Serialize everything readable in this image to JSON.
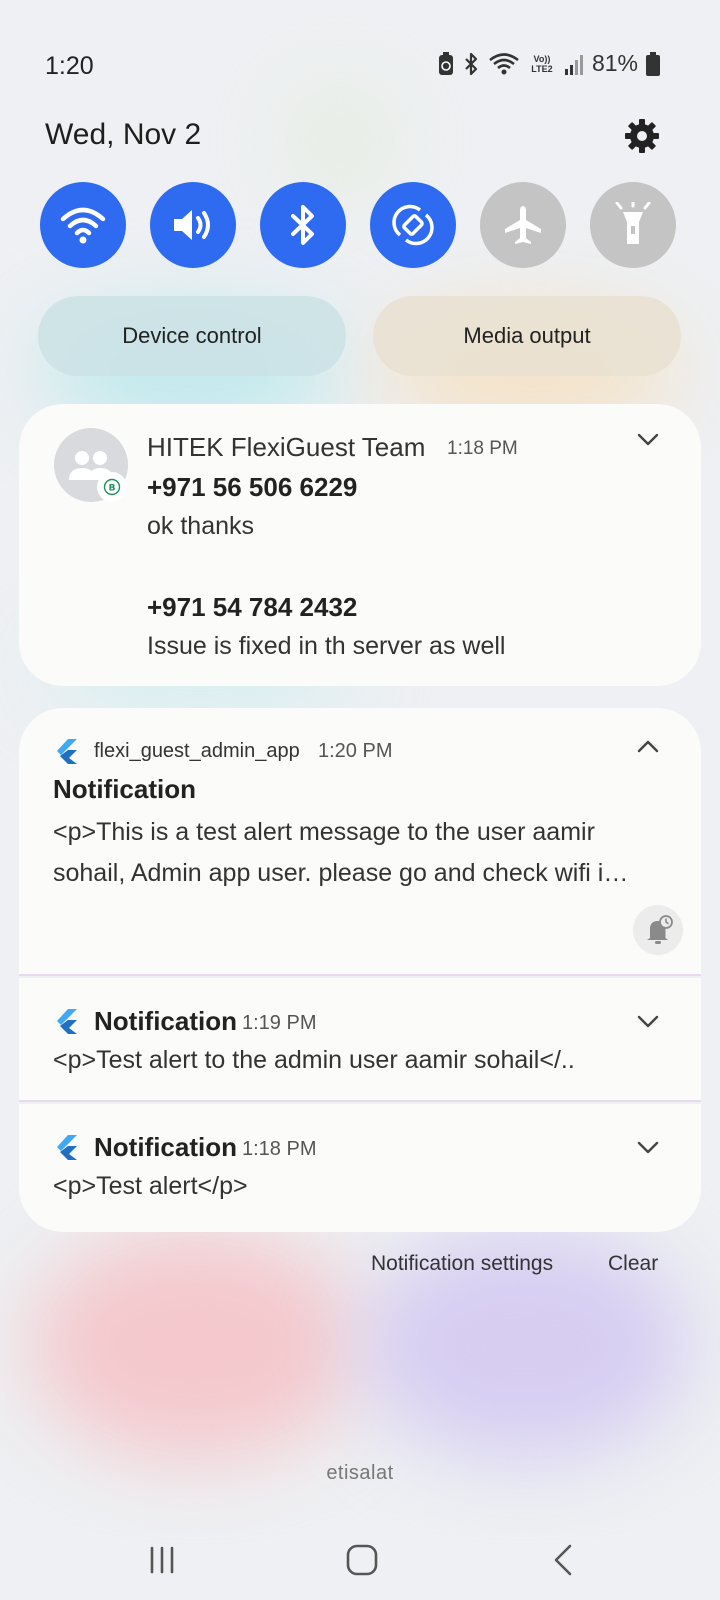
{
  "status_bar": {
    "time": "1:20",
    "network": "Vo)) LTE2",
    "battery": "81%"
  },
  "header": {
    "date": "Wed, Nov 2"
  },
  "quick_tiles": [
    {
      "name": "wifi",
      "state": "on"
    },
    {
      "name": "sound",
      "state": "on"
    },
    {
      "name": "bluetooth",
      "state": "on"
    },
    {
      "name": "auto-rotate",
      "state": "on"
    },
    {
      "name": "airplane-mode",
      "state": "off"
    },
    {
      "name": "flashlight",
      "state": "off"
    }
  ],
  "controls": {
    "device_control": "Device control",
    "media_output": "Media output"
  },
  "notifications": [
    {
      "title": "HITEK FlexiGuest Team",
      "time": "1:18 PM",
      "messages": [
        {
          "sender": "+971 56 506 6229",
          "text": "ok thanks"
        },
        {
          "sender": "+971 54 784 2432",
          "text": "Issue is fixed in th server as well"
        }
      ]
    },
    {
      "app": "flexi_guest_admin_app",
      "time": "1:20 PM",
      "title": "Notification",
      "body": "<p>This is a test alert message to the user aamir sohail, Admin app user. please go and check wifi i…"
    },
    {
      "title": "Notification",
      "time": "1:19 PM",
      "body": "<p>Test alert to the admin user aamir sohail</.."
    },
    {
      "title": "Notification",
      "time": "1:18 PM",
      "body": "<p>Test alert</p>"
    }
  ],
  "footer": {
    "settings": "Notification settings",
    "clear": "Clear",
    "carrier": "etisalat"
  },
  "colors": {
    "accent": "#2f6bf1",
    "tile_off": "#c4c4c4",
    "card": "#fbfbfa",
    "flutter": "#3fa9f5"
  }
}
